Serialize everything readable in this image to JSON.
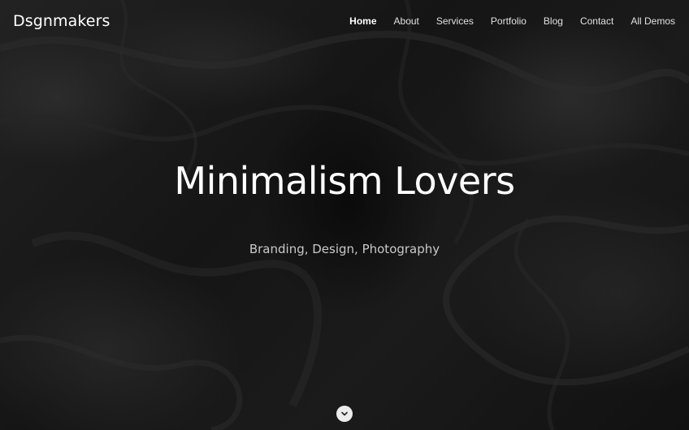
{
  "brand": {
    "name": "Dsgnmakers"
  },
  "nav": {
    "items": [
      {
        "label": "Home",
        "active": true
      },
      {
        "label": "About"
      },
      {
        "label": "Services"
      },
      {
        "label": "Portfolio"
      },
      {
        "label": "Blog"
      },
      {
        "label": "Contact"
      },
      {
        "label": "All Demos"
      }
    ]
  },
  "hero": {
    "title": "Minimalism Lovers",
    "subtitle": "Branding, Design, Photography",
    "background": "dark-marble-texture"
  },
  "scroll_button": {
    "icon": "chevron-down-icon"
  },
  "colors": {
    "background": "#161616",
    "text": "#ffffff",
    "subtitle": "#c9c9c9",
    "scroll_button": "#ececec"
  }
}
